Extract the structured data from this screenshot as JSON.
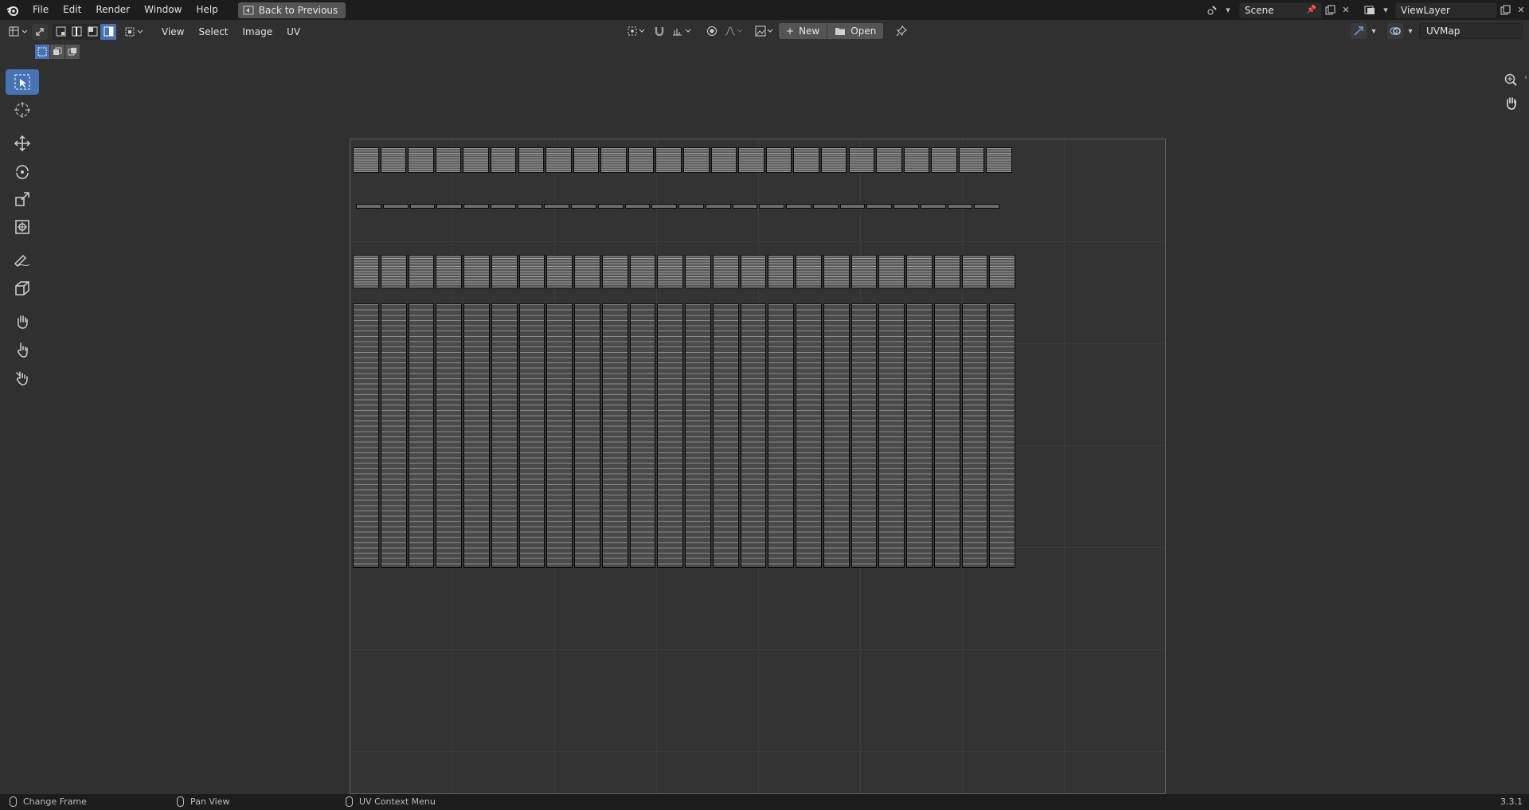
{
  "topbar": {
    "menus": [
      "File",
      "Edit",
      "Render",
      "Window",
      "Help"
    ],
    "back_label": "Back to Previous",
    "scene_name": "Scene",
    "view_layer": "ViewLayer"
  },
  "header": {
    "menus": [
      "View",
      "Select",
      "Image",
      "UV"
    ],
    "new_label": "New",
    "open_label": "Open",
    "uv_map": "UVMap"
  },
  "toolbar": {
    "tools": [
      "select-box",
      "cursor",
      "move",
      "rotate",
      "scale",
      "transform",
      "annotate",
      "rip-region",
      "grab",
      "relax",
      "pinch"
    ],
    "active": "select-box"
  },
  "statusbar": {
    "left": "Change Frame",
    "middle": "Pan View",
    "right": "UV Context Menu",
    "version": "3.3.1"
  },
  "colors": {
    "accent": "#4772b3",
    "background": "#303030",
    "header": "#1d1d1d"
  }
}
